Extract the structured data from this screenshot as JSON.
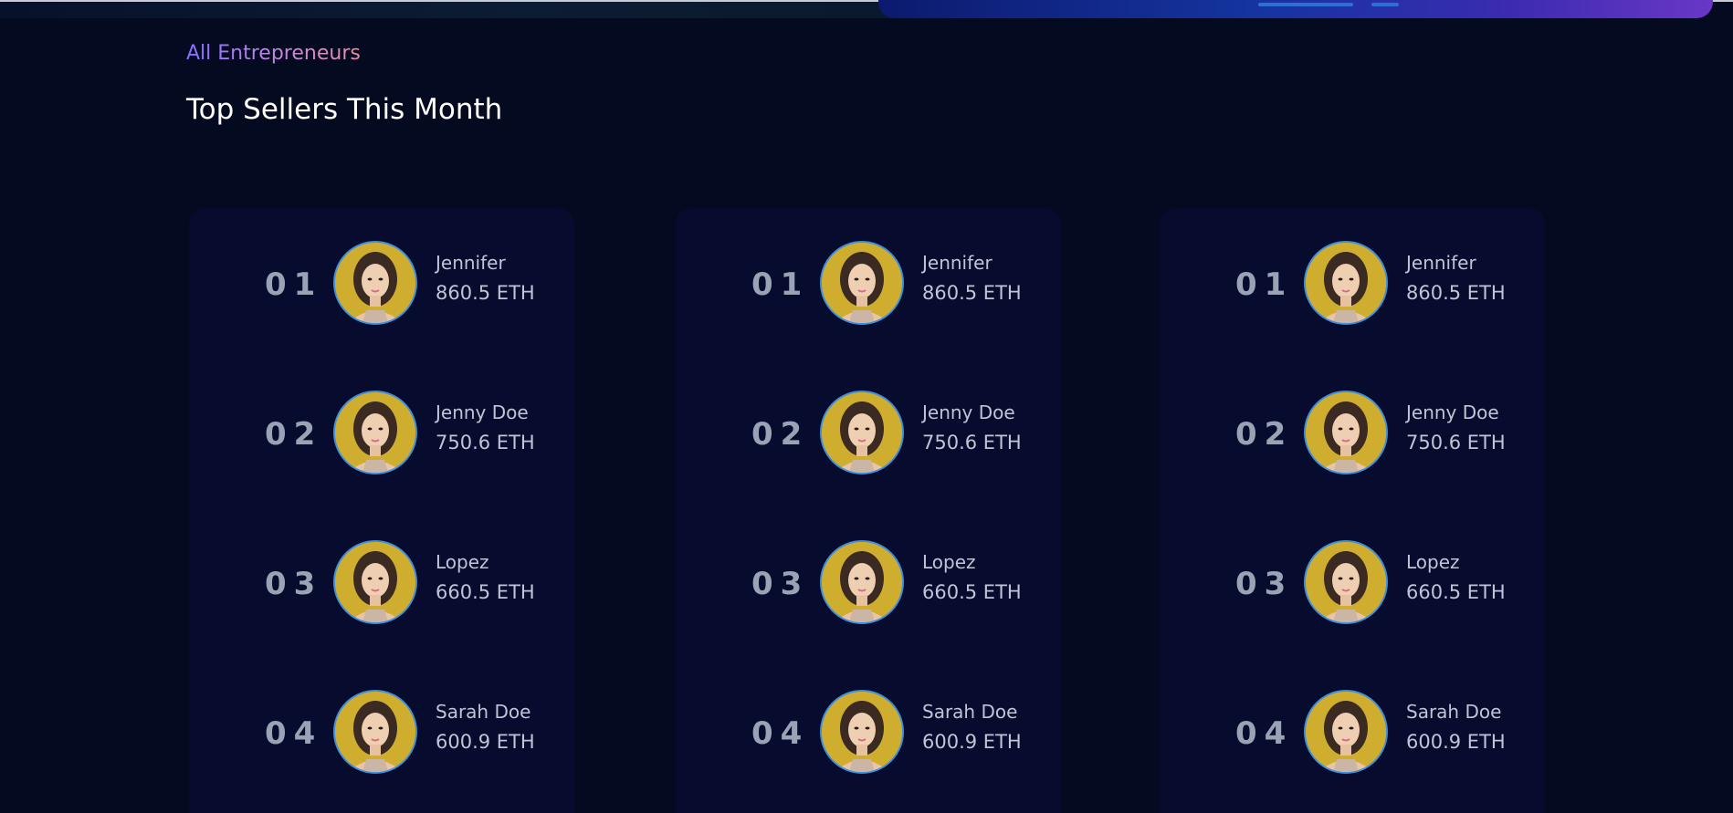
{
  "header": {
    "eyebrow": "All Entrepreneurs",
    "title": "Top Sellers This Month"
  },
  "panels": [
    {
      "sellers": [
        {
          "rank": "01",
          "name": "Jennifer",
          "amount": "860.5 ETH"
        },
        {
          "rank": "02",
          "name": "Jenny Doe",
          "amount": "750.6 ETH"
        },
        {
          "rank": "03",
          "name": "Lopez",
          "amount": "660.5 ETH"
        },
        {
          "rank": "04",
          "name": "Sarah Doe",
          "amount": "600.9 ETH"
        }
      ]
    },
    {
      "sellers": [
        {
          "rank": "01",
          "name": "Jennifer",
          "amount": "860.5 ETH"
        },
        {
          "rank": "02",
          "name": "Jenny Doe",
          "amount": "750.6 ETH"
        },
        {
          "rank": "03",
          "name": "Lopez",
          "amount": "660.5 ETH"
        },
        {
          "rank": "04",
          "name": "Sarah Doe",
          "amount": "600.9 ETH"
        }
      ]
    },
    {
      "sellers": [
        {
          "rank": "01",
          "name": "Jennifer",
          "amount": "860.5 ETH"
        },
        {
          "rank": "02",
          "name": "Jenny Doe",
          "amount": "750.6 ETH"
        },
        {
          "rank": "03",
          "name": "Lopez",
          "amount": "660.5 ETH"
        },
        {
          "rank": "04",
          "name": "Sarah Doe",
          "amount": "600.9 ETH"
        }
      ]
    }
  ],
  "colors": {
    "background": "#040a1f",
    "panel": "#070c2e",
    "avatar_ring": "#3d8fe0",
    "text_muted": "#bfc5d6",
    "rank": "#9aa3b5"
  }
}
